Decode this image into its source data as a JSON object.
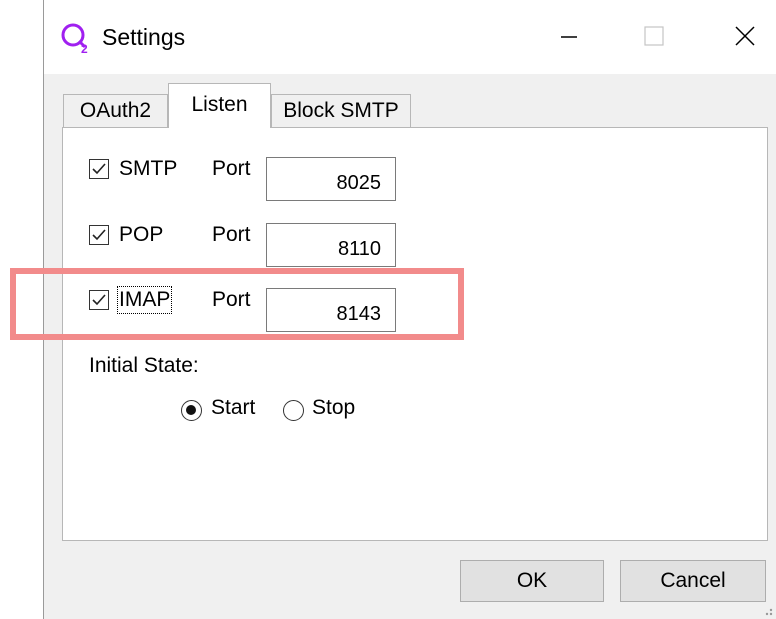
{
  "window": {
    "title": "Settings",
    "icon": "o2-app-icon",
    "icon_color": "#a020f0",
    "controls": [
      "minimize-icon",
      "maximize-icon",
      "close-icon"
    ]
  },
  "tabs": [
    {
      "label": "OAuth2",
      "active": false
    },
    {
      "label": "Listen",
      "active": true
    },
    {
      "label": "Block SMTP",
      "active": false
    }
  ],
  "listen": {
    "rows": [
      {
        "label": "SMTP",
        "checked": true,
        "port_label": "Port",
        "port": "8025"
      },
      {
        "label": "POP",
        "checked": true,
        "port_label": "Port",
        "port": "8110"
      },
      {
        "label": "IMAP",
        "checked": true,
        "port_label": "Port",
        "port": "8143",
        "focused": true
      }
    ],
    "initial_state_label": "Initial State:",
    "options": [
      {
        "label": "Start",
        "selected": true
      },
      {
        "label": "Stop",
        "selected": false
      }
    ]
  },
  "buttons": {
    "ok": "OK",
    "cancel": "Cancel"
  },
  "highlight": {
    "color": "#f28b8b",
    "target": "IMAP"
  }
}
